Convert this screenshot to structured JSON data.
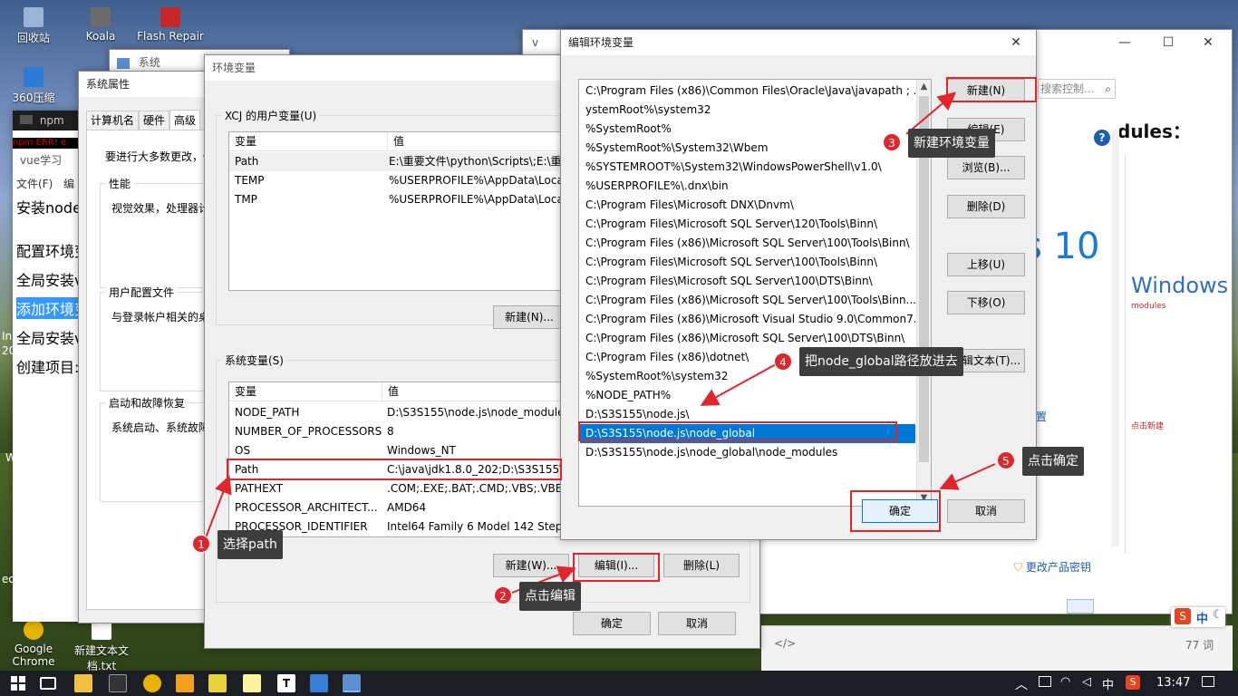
{
  "desktop_icons": [
    {
      "label": "回收站",
      "color": "#9ab4d6"
    },
    {
      "label": "Koala",
      "color": "#6b6b6b"
    },
    {
      "label": "Flash Repair",
      "color": "#c62828"
    },
    {
      "label": "360压缩",
      "color": "#2e7bd6"
    },
    {
      "label": "Google Chrome",
      "color": "#e8b300"
    },
    {
      "label": "新建文本文档.txt",
      "color": "#ffffff"
    }
  ],
  "bg_windows": {
    "vue_title": "v",
    "npm_title": "npm",
    "npm_err": "npm ERR! e",
    "doc_title": "vue学习",
    "doc_menu": [
      "文件(F)",
      "编"
    ],
    "doc_lines": [
      "安装node.",
      "配置环境变",
      "全局安装v",
      "添加环境变",
      "全局安装v",
      "创建项目:"
    ],
    "right_search": "搜索控制...",
    "right_heading": "dules：",
    "right_win10": "s 10",
    "right_windows": "Windows",
    "right_modules": "modules",
    "right_settings": "设置",
    "right_newtext": "点击新建",
    "right_product_key": "更改产品密钥",
    "right_edge_chars": [
      "In",
      "20",
      "eo",
      "W"
    ],
    "word_count": "77 词",
    "code_icon": "</>",
    "ime_labels": [
      "中"
    ]
  },
  "system_props": {
    "title": "系统属性",
    "tabs": [
      "计算机名",
      "硬件",
      "高级"
    ],
    "intro": "要进行大多数更改，你",
    "perf_title": "性能",
    "perf_text": "视觉效果，处理器计",
    "profile_title": "用户配置文件",
    "profile_text": "与登录帐户相关的桌",
    "startup_title": "启动和故障恢复",
    "startup_text": "系统启动、系统故障"
  },
  "system_win": {
    "title": "系统"
  },
  "env_vars": {
    "title": "环境变量",
    "user_group": "XCJ 的用户变量(U)",
    "col_var": "变量",
    "col_val": "值",
    "user_rows": [
      {
        "var": "Path",
        "val": "E:\\重要文件\\python\\Scripts\\;E:\\重要"
      },
      {
        "var": "TEMP",
        "val": "%USERPROFILE%\\AppData\\Local"
      },
      {
        "var": "TMP",
        "val": "%USERPROFILE%\\AppData\\Local"
      }
    ],
    "user_new": "新建(N)...",
    "sys_group": "系统变量(S)",
    "sys_rows": [
      {
        "var": "NODE_PATH",
        "val": "D:\\S3S155\\node.js\\node_module"
      },
      {
        "var": "NUMBER_OF_PROCESSORS",
        "val": "8"
      },
      {
        "var": "OS",
        "val": "Windows_NT"
      },
      {
        "var": "Path",
        "val": "C:\\java\\jdk1.8.0_202;D:\\S3S155\\n"
      },
      {
        "var": "PATHEXT",
        "val": ".COM;.EXE;.BAT;.CMD;.VBS;.VBE;."
      },
      {
        "var": "PROCESSOR_ARCHITECT...",
        "val": "AMD64"
      },
      {
        "var": "PROCESSOR_IDENTIFIER",
        "val": "Intel64 Family 6 Model 142 Stepp"
      }
    ],
    "sys_new": "新建(W)...",
    "sys_edit": "编辑(I)...",
    "sys_delete": "删除(L)",
    "ok": "确定",
    "cancel": "取消"
  },
  "edit_env": {
    "title": "编辑环境变量",
    "close": "✕",
    "paths": [
      "C:\\Program Files (x86)\\Common Files\\Oracle\\Java\\javapath ; ...",
      "ystemRoot%\\system32",
      "%SystemRoot%",
      "%SystemRoot%\\System32\\Wbem",
      "%SYSTEMROOT%\\System32\\WindowsPowerShell\\v1.0\\",
      "%USERPROFILE%\\.dnx\\bin",
      "C:\\Program Files\\Microsoft DNX\\Dnvm\\",
      "C:\\Program Files\\Microsoft SQL Server\\120\\Tools\\Binn\\",
      "C:\\Program Files (x86)\\Microsoft SQL Server\\100\\Tools\\Binn\\",
      "C:\\Program Files\\Microsoft SQL Server\\100\\Tools\\Binn\\",
      "C:\\Program Files\\Microsoft SQL Server\\100\\DTS\\Binn\\",
      "C:\\Program Files (x86)\\Microsoft SQL Server\\100\\Tools\\Binn...",
      "C:\\Program Files (x86)\\Microsoft Visual Studio 9.0\\Common7...",
      "C:\\Program Files (x86)\\Microsoft SQL Server\\100\\DTS\\Binn\\",
      "C:\\Program Files (x86)\\dotnet\\",
      "%SystemRoot%\\system32",
      "%NODE_PATH%",
      "D:\\S3S155\\node.js\\",
      "D:\\S3S155\\node.js\\node_global",
      "D:\\S3S155\\node.js\\node_global\\node_modules"
    ],
    "selected_index": 18,
    "buttons": {
      "new": "新建(N)",
      "edit": "编辑(E)",
      "browse": "浏览(B)...",
      "delete": "删除(D)",
      "up": "上移(U)",
      "down": "下移(O)",
      "edit_text": "编辑文本(T)..."
    },
    "ok": "确定",
    "cancel": "取消"
  },
  "annotations": [
    {
      "num": "1",
      "text": "选择path"
    },
    {
      "num": "2",
      "text": "点击编辑"
    },
    {
      "num": "3",
      "text": "新建环境变量"
    },
    {
      "num": "4",
      "text": "把node_global路径放进去"
    },
    {
      "num": "5",
      "text": "点击确定"
    }
  ],
  "taskbar": {
    "time": "13:47",
    "ime": "中",
    "notification_icon": "action-center-icon"
  },
  "colors": {
    "accent_red": "#e0252b",
    "selection": "#0078d7",
    "callout_bg": "#3d3d3d",
    "taskbar": "#1b1f25"
  }
}
